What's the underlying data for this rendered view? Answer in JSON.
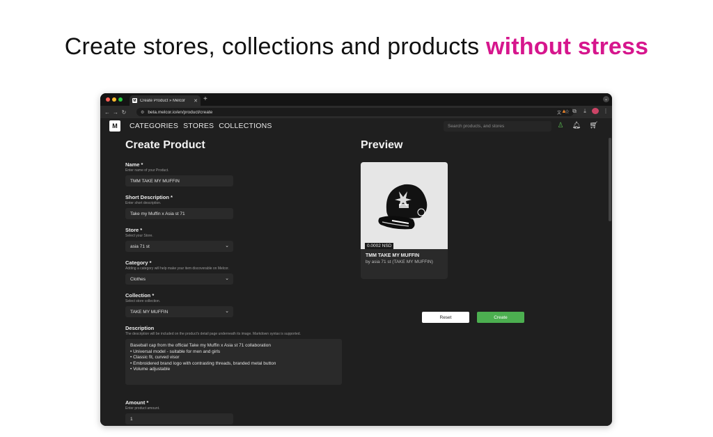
{
  "headline": {
    "prefix": "Create stores, collections and products ",
    "accent": "without stress"
  },
  "browser": {
    "tab_title": "Create Product » Melcor",
    "tab_icon": "M",
    "url": "beta.melcor.io/en/product/create"
  },
  "nav": {
    "logo_text": "M",
    "links": [
      "CATEGORIES",
      "STORES",
      "COLLECTIONS"
    ],
    "search_placeholder": "Search products, and stores"
  },
  "form": {
    "title": "Create Product",
    "name": {
      "label": "Name *",
      "help": "Enter name of your Product.",
      "value": "TMM TAKE MY MUFFIN"
    },
    "short_description": {
      "label": "Short Description *",
      "help": "Enter short description.",
      "value": "Take my Muffin x Asia st 71"
    },
    "store": {
      "label": "Store *",
      "help": "Select your Store.",
      "value": "asia 71 st"
    },
    "category": {
      "label": "Category *",
      "help": "Adding a category will help make your item discoverable on Melcor.",
      "value": "Clothes"
    },
    "collection": {
      "label": "Collection *",
      "help": "Select store collection.",
      "value": "TAKE MY MUFFIN"
    },
    "description": {
      "label": "Description",
      "help": "The description will be included on the product's detail page underneath its image. Markdown syntax is supported.",
      "lines": [
        "Baseball cap from the official Take my Muffin x Asia st 71 collaboration",
        "• Universal model - suitable for men and girls",
        "• Classic fit, curved visor",
        "• Embroidered brand logo with contrasting threads, branded metal button",
        "• Volume adjustable"
      ]
    },
    "amount": {
      "label": "Amount *",
      "help": "Enter product amount.",
      "value": "1"
    }
  },
  "preview": {
    "title": "Preview",
    "price": "0.0002 NSD",
    "product_title": "TMM TAKE MY MUFFIN",
    "byline": "by asia 71 st (TAKE MY MUFFIN)",
    "reset_label": "Reset",
    "create_label": "Create"
  },
  "colors": {
    "accent": "#d6168d",
    "create_button": "#4caf50",
    "background": "#1f1f1f"
  },
  "icons": [
    "back-icon",
    "forward-icon",
    "reload-icon",
    "site-info-icon",
    "translate-icon",
    "star-icon",
    "metamask-icon",
    "extensions-icon",
    "download-icon",
    "profile-icon",
    "menu-icon",
    "user-icon",
    "bell-icon",
    "cart-icon",
    "chevron-down-icon"
  ]
}
